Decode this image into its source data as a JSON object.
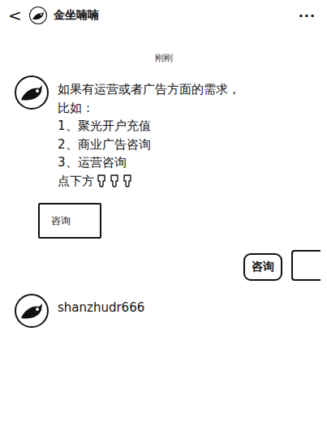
{
  "header": {
    "back": "<",
    "title": "金坐喃喃",
    "more": "···"
  },
  "timestamp": "刚刚",
  "messages": [
    {
      "kind": "text",
      "side": "left",
      "lines": [
        "如果有运营或者广告方面的需求，",
        "比如：",
        "1、聚光开户充值",
        "2、商业广告咨询",
        "3、运营咨询"
      ],
      "hint": "点下方",
      "pointers": 3
    },
    {
      "kind": "button",
      "side": "left",
      "label": "咨询"
    },
    {
      "kind": "bubble",
      "side": "right",
      "text": "咨询"
    },
    {
      "kind": "text",
      "side": "left",
      "lines": [
        "shanzhudr666"
      ],
      "hint": "",
      "pointers": 0
    }
  ]
}
